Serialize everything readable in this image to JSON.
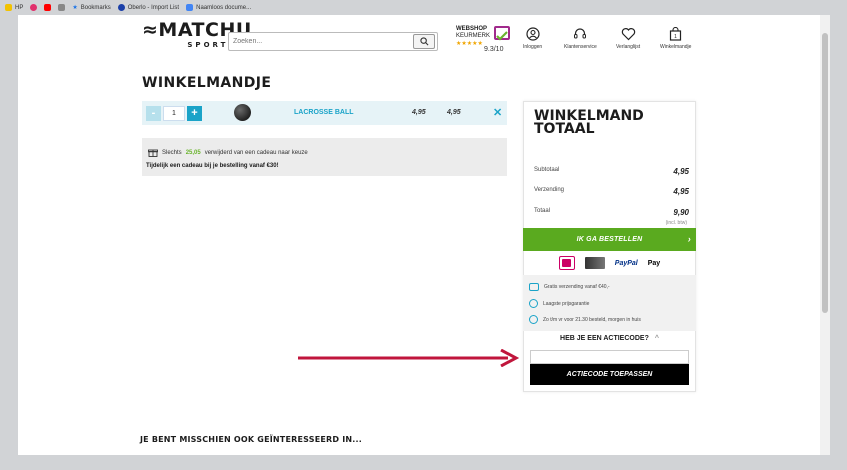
{
  "bookmarks": [
    {
      "label": "HP",
      "color": "#f2c200"
    },
    {
      "label": "",
      "color": "#e1306c"
    },
    {
      "label": "",
      "color": "#ff0000"
    },
    {
      "label": "",
      "color": "#888888"
    },
    {
      "label": "Bookmarks",
      "color": "#1a73e8"
    },
    {
      "label": "Oberlo - Import List",
      "color": "#1a3fa8"
    },
    {
      "label": "Naamloos docume...",
      "color": "#4285f4"
    }
  ],
  "header": {
    "logo_main": "MATCHU",
    "logo_sub": "SPORTS",
    "search_placeholder": "Zoeken...",
    "keurmerk_line1": "WEBSHOP",
    "keurmerk_line2": "KEURMERK",
    "keurmerk_stars": "★★★★★",
    "keurmerk_score": "9.3/10",
    "nav": {
      "login": "Inloggen",
      "service": "Klantenservice",
      "wishlist": "Verlanglijst",
      "cart": "Winkelmandje",
      "cart_count": "1"
    }
  },
  "page_title": "WINKELMANDJE",
  "cart": {
    "items": [
      {
        "quantity": "1",
        "name": "LACROSSE BALL",
        "unit_price": "4,95",
        "total_price": "4,95"
      }
    ],
    "minus": "-",
    "plus": "+",
    "remove": "✕"
  },
  "gift": {
    "prefix": "Slechts",
    "amount": "25,05",
    "suffix": "verwijderd van een cadeau naar keuze",
    "promo": "Tijdelijk een cadeau bij je bestelling vanaf €30!"
  },
  "totals": {
    "title": "WINKELMAND TOTAAL",
    "subtotal_label": "Subtotaal",
    "subtotal_value": "4,95",
    "shipping_label": "Verzending",
    "shipping_value": "4,95",
    "total_label": "Totaal",
    "total_value": "9,90",
    "vat_note": "(incl. btw)",
    "order_button": "IK GA BESTELLEN",
    "order_chevron": "›"
  },
  "payment": {
    "paypal": "PayPal",
    "applepay": "Pay"
  },
  "usps": [
    "Gratis verzending vanaf €40,-",
    "Laagste prijsgarantie",
    "Zo t/m vr voor 21.30 besteld, morgen in huis"
  ],
  "coupon": {
    "heading": "HEB JE EEN ACTIECODE?",
    "chevron": "^",
    "input_value": "",
    "button": "ACTIECODE TOEPASSEN"
  },
  "interest_heading": "JE BENT MISSCHIEN OOK GEÏNTERESSEERD IN...",
  "colors": {
    "accent_blue": "#1aa3c8",
    "order_green": "#5aaa1f",
    "annotation_arrow": "#c0163c"
  }
}
